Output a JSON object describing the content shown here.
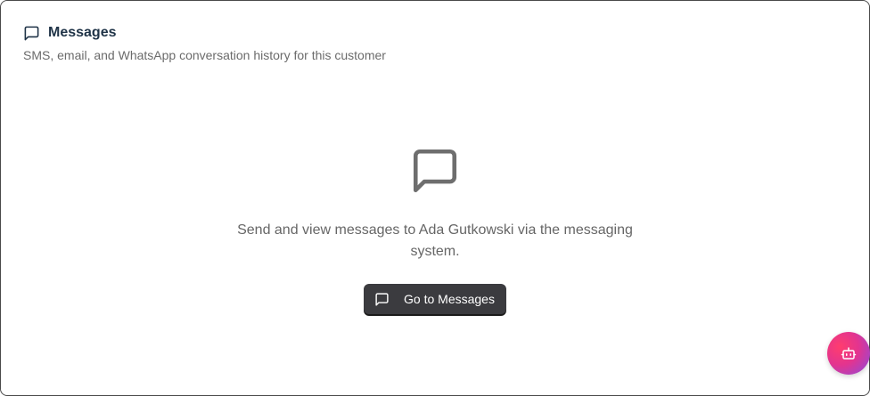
{
  "header": {
    "title": "Messages",
    "subtitle": "SMS, email, and WhatsApp conversation history for this customer",
    "icon": "message-square-icon"
  },
  "empty_state": {
    "icon": "message-square-icon",
    "text": "Send and view messages to Ada Gutkowski via the messaging system."
  },
  "cta": {
    "label": "Go to Messages",
    "icon": "message-square-icon"
  },
  "fab": {
    "icon": "bot-icon"
  },
  "colors": {
    "title": "#1f3347",
    "button_bg": "#3b3b3f",
    "fab_start": "#ff3d6e",
    "fab_end": "#8a4be0"
  }
}
